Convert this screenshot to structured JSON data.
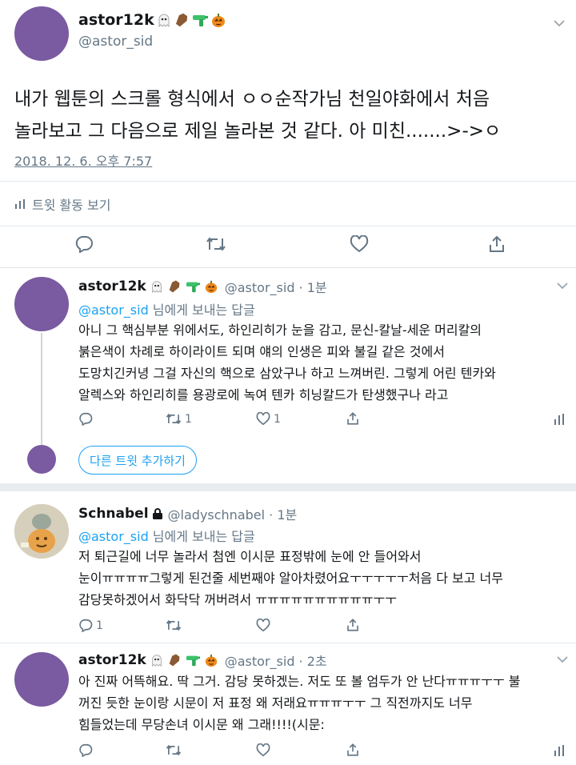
{
  "main_tweet": {
    "display_name": "astor12k",
    "handle": "@astor_sid",
    "text_line1": "내가 웹툰의 스크롤 형식에서 ㅇㅇ순작가님 천일야화에서 처음",
    "text_line2": "놀라보고 그 다음으로 제일 놀라본 것 같다. 아 미친.......>->ㅇ",
    "timestamp": "2018. 12. 6. 오후 7:57",
    "activity_label": "트윗 활동 보기"
  },
  "reply1": {
    "display_name": "astor12k",
    "meta": "@astor_sid · 1분",
    "reply_to_handle": "@astor_sid",
    "reply_to_suffix": " 님에게 보내는 답글",
    "lines": [
      "아니 그 핵심부분 위에서도, 하인리히가 눈을 감고, 문신-칼날-세운 머리칼의",
      "붉은색이 차례로 하이라이트 되며 얘의 인생은 피와 불길 같은 것에서",
      "도망치긴커녕 그걸 자신의 핵으로 삼았구나 하고 느껴버린. 그렇게 어린 텐카와",
      "알렉스와 하인리히를 용광로에 녹여 텐카 히닝칼드가 탄생했구나 라고"
    ],
    "retweet_count": "1",
    "like_count": "1"
  },
  "add_tweet_label": "다른 트윗 추가하기",
  "reply2": {
    "display_name": "Schnabel",
    "meta": "@ladyschnabel · 1분",
    "reply_to_handle": "@astor_sid",
    "reply_to_suffix": " 님에게 보내는 답글",
    "lines": [
      "저 퇴근길에 너무 놀라서 첨엔 이시문 표정밖에 눈에 안 들어와서",
      "눈이ㅠㅠㅠㅠ그렇게 된건줄 세번째야 알아차렸어요ㅜㅜㅜㅜㅜ처음 다 보고 너무",
      "감당못하겠어서 화닥닥 꺼버려서 ㅠㅠㅠㅠㅠㅠㅠㅠㅠㅠㅜㅜ"
    ],
    "comment_count": "1"
  },
  "reply3": {
    "display_name": "astor12k",
    "meta": "@astor_sid · 2초",
    "lines": [
      "아 진짜 어뜩해요. 딱 그거. 감당 못하겠는. 저도 또 볼 엄두가 안 난다ㅠㅠㅠㅜㅜ 불",
      "꺼진 듯한 눈이랑 시문이 저 표정 왜 저래요ㅠㅠㅠㅜㅜ 그 직전까지도 너무",
      "힘들었는데 무당손녀 이시문 왜 그래!!!!(시문:"
    ]
  },
  "icons": [
    "ghost-icon",
    "coffin-icon",
    "water-gun-icon",
    "pumpkin-icon",
    "lock-icon",
    "chevron-down-icon",
    "reply-icon",
    "retweet-icon",
    "like-icon",
    "share-icon",
    "analytics-icon"
  ],
  "colors": {
    "accent": "#1da1f2",
    "avatar": "#7a5aa0",
    "muted": "#657786",
    "divider": "#e1e8ed"
  }
}
